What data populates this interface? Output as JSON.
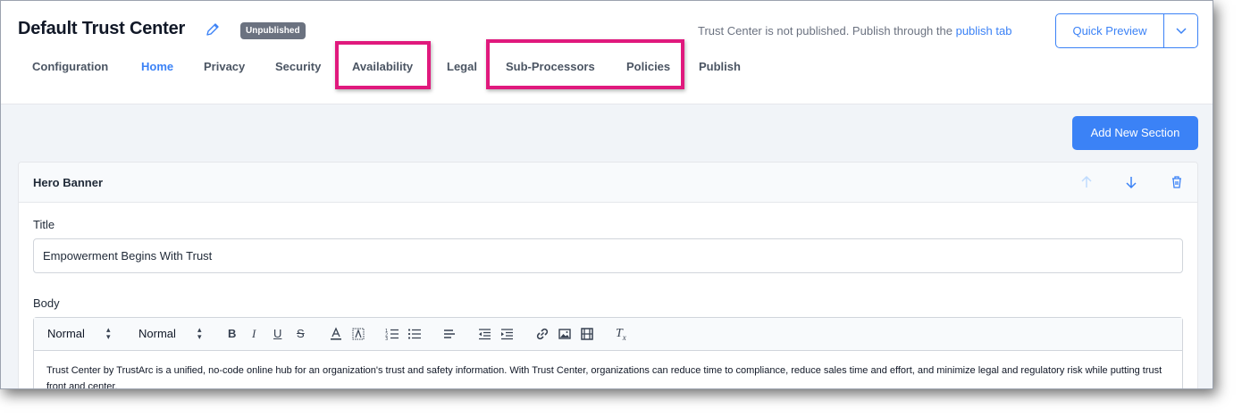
{
  "header": {
    "title": "Default Trust Center",
    "status_badge": "Unpublished",
    "notice_text": "Trust Center is not published. Publish through the",
    "notice_link": "publish tab",
    "quick_preview_label": "Quick Preview"
  },
  "tabs": [
    {
      "label": "Configuration",
      "active": false
    },
    {
      "label": "Home",
      "active": true
    },
    {
      "label": "Privacy",
      "active": false
    },
    {
      "label": "Security",
      "active": false
    },
    {
      "label": "Availability",
      "active": false
    },
    {
      "label": "Legal",
      "active": false
    },
    {
      "label": "Sub-Processors",
      "active": false
    },
    {
      "label": "Policies",
      "active": false
    },
    {
      "label": "Publish",
      "active": false
    }
  ],
  "content": {
    "add_section_label": "Add New Section",
    "section": {
      "name": "Hero Banner",
      "title_label": "Title",
      "title_value": "Empowerment Begins With Trust",
      "body_label": "Body",
      "toolbar": {
        "font_select": "Normal",
        "size_select": "Normal"
      },
      "body_text": "Trust Center by TrustArc is a unified, no-code online hub for an organization's trust and safety information. With Trust Center, organizations can reduce time to compliance, reduce sales time and effort, and minimize legal and regulatory risk while putting trust front and center."
    }
  },
  "colors": {
    "accent": "#3b82f6",
    "highlight": "#e0197d",
    "badge_bg": "#6b7280",
    "content_bg": "#f1f4f8"
  },
  "icons": [
    "pencil-icon",
    "chevron-down-icon",
    "arrow-up-icon",
    "arrow-down-icon",
    "trash-icon",
    "bold-icon",
    "italic-icon",
    "underline-icon",
    "strikethrough-icon",
    "text-color-icon",
    "highlight-icon",
    "ordered-list-icon",
    "bullet-list-icon",
    "align-left-icon",
    "outdent-icon",
    "indent-icon",
    "link-icon",
    "image-icon",
    "video-icon",
    "clear-format-icon"
  ]
}
